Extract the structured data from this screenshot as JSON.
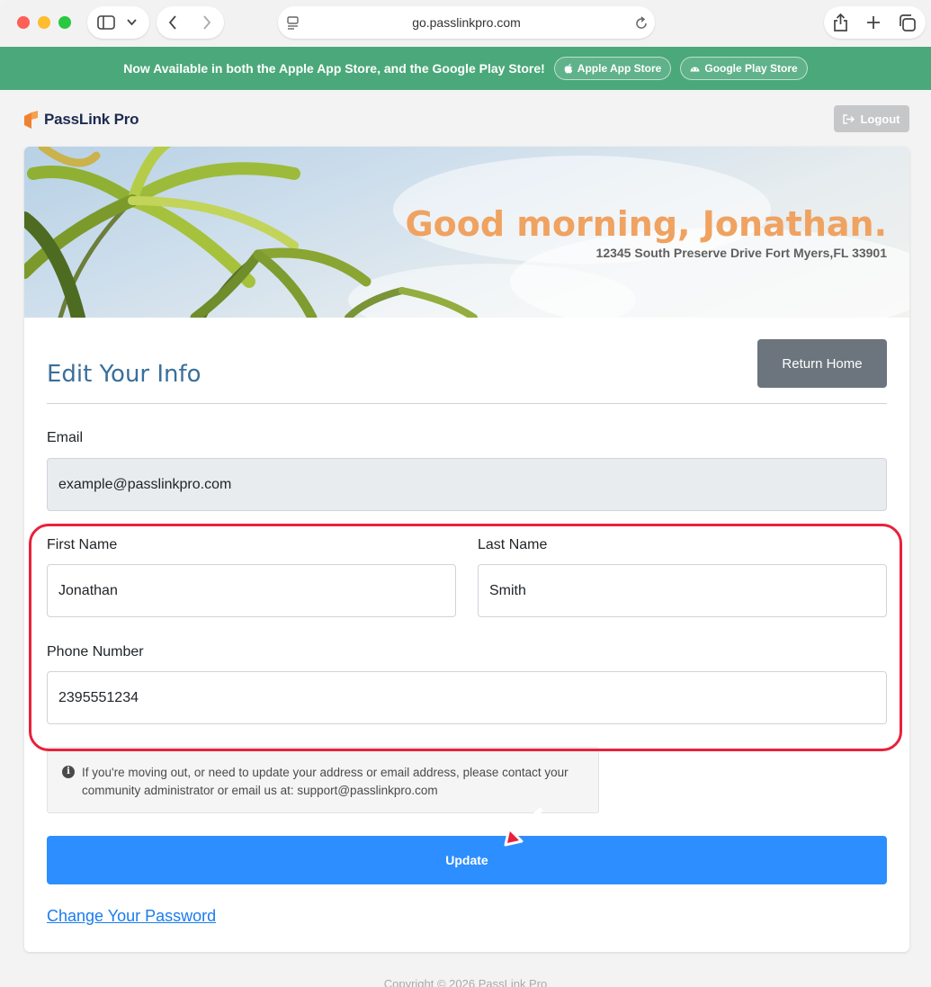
{
  "browser": {
    "url": "go.passlinkpro.com"
  },
  "promo": {
    "text": "Now Available in both the Apple App Store, and the Google Play Store!",
    "apple_label": "Apple App Store",
    "google_label": "Google Play Store"
  },
  "header": {
    "logo_text": "PassLink Pro",
    "logout_label": "Logout"
  },
  "hero": {
    "greeting": "Good morning, Jonathan.",
    "address": "12345 South Preserve Drive Fort Myers,FL 33901"
  },
  "form": {
    "title": "Edit Your Info",
    "return_label": "Return Home",
    "email_label": "Email",
    "email_value": "example@passlinkpro.com",
    "first_name_label": "First Name",
    "first_name_value": "Jonathan",
    "last_name_label": "Last Name",
    "last_name_value": "Smith",
    "phone_label": "Phone Number",
    "phone_value": "2395551234",
    "notice": "If you're moving out, or need to update your address or email address, please contact your community administrator or email us at: support@passlinkpro.com",
    "update_label": "Update",
    "password_link": "Change Your Password"
  },
  "footer": {
    "copyright": "Copyright © 2026 PassLink Pro"
  },
  "colors": {
    "promo_bg": "#4ba87a",
    "accent_blue": "#2d8eff",
    "greeting": "#f0a260",
    "highlight": "#e8213b"
  }
}
